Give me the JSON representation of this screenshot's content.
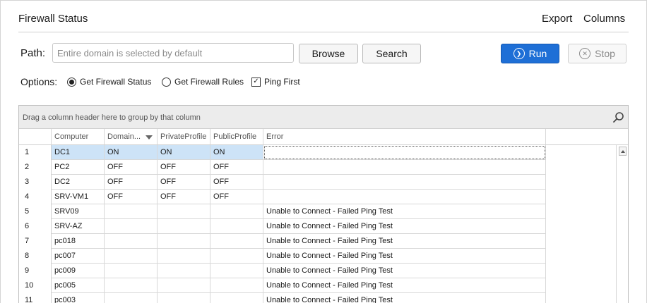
{
  "header": {
    "title": "Firewall Status",
    "export_label": "Export",
    "columns_label": "Columns"
  },
  "path": {
    "label": "Path:",
    "placeholder": "Entire domain is selected by default",
    "value": ""
  },
  "buttons": {
    "browse": "Browse",
    "search": "Search",
    "run": "Run",
    "stop": "Stop"
  },
  "options": {
    "label": "Options:",
    "get_firewall_status": {
      "label": "Get Firewall Status",
      "checked": true
    },
    "get_firewall_rules": {
      "label": "Get Firewall Rules",
      "checked": false
    },
    "ping_first": {
      "label": "Ping First",
      "checked": true
    }
  },
  "grid": {
    "group_panel_text": "Drag a column header here to group by that column",
    "columns": [
      "Computer",
      "Domain...",
      "PrivateProfile",
      "PublicProfile",
      "Error"
    ],
    "rows": [
      {
        "num": "1",
        "computer": "DC1",
        "domain": "ON",
        "private": "ON",
        "public": "ON",
        "error": "",
        "selected": true
      },
      {
        "num": "2",
        "computer": "PC2",
        "domain": "OFF",
        "private": "OFF",
        "public": "OFF",
        "error": ""
      },
      {
        "num": "3",
        "computer": "DC2",
        "domain": "OFF",
        "private": "OFF",
        "public": "OFF",
        "error": ""
      },
      {
        "num": "4",
        "computer": "SRV-VM1",
        "domain": "OFF",
        "private": "OFF",
        "public": "OFF",
        "error": ""
      },
      {
        "num": "5",
        "computer": "SRV09",
        "domain": "",
        "private": "",
        "public": "",
        "error": "Unable to Connect - Failed Ping Test"
      },
      {
        "num": "6",
        "computer": "SRV-AZ",
        "domain": "",
        "private": "",
        "public": "",
        "error": "Unable to Connect - Failed Ping Test"
      },
      {
        "num": "7",
        "computer": "pc018",
        "domain": "",
        "private": "",
        "public": "",
        "error": "Unable to Connect - Failed Ping Test"
      },
      {
        "num": "8",
        "computer": "pc007",
        "domain": "",
        "private": "",
        "public": "",
        "error": "Unable to Connect - Failed Ping Test"
      },
      {
        "num": "9",
        "computer": "pc009",
        "domain": "",
        "private": "",
        "public": "",
        "error": "Unable to Connect - Failed Ping Test"
      },
      {
        "num": "10",
        "computer": "pc005",
        "domain": "",
        "private": "",
        "public": "",
        "error": "Unable to Connect - Failed Ping Test"
      },
      {
        "num": "11",
        "computer": "pc003",
        "domain": "",
        "private": "",
        "public": "",
        "error": "Unable to Connect - Failed Ping Test"
      }
    ]
  },
  "icons": {
    "run": "circle-chevron-right-icon",
    "stop": "circle-x-icon",
    "search": "magnifier-icon",
    "sort": "sort-descending-icon"
  },
  "colors": {
    "run_button": "#1e6fd6",
    "selected_row": "#cde3f7"
  }
}
